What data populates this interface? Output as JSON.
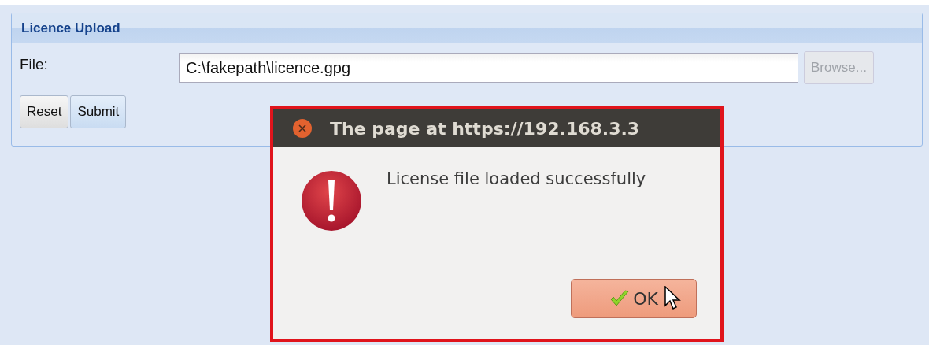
{
  "panel": {
    "title": "Licence Upload",
    "file_label": "File:",
    "file_value": "C:\\fakepath\\licence.gpg",
    "browse_button": {
      "label": "Browse...",
      "disabled": true
    },
    "buttons": [
      {
        "label": "Reset",
        "highlighted": false
      },
      {
        "label": "Submit",
        "highlighted": true
      }
    ]
  },
  "dialog": {
    "title": "The page at https://192.168.3.3",
    "message": "License file loaded successfully",
    "ok_button": "OK"
  }
}
